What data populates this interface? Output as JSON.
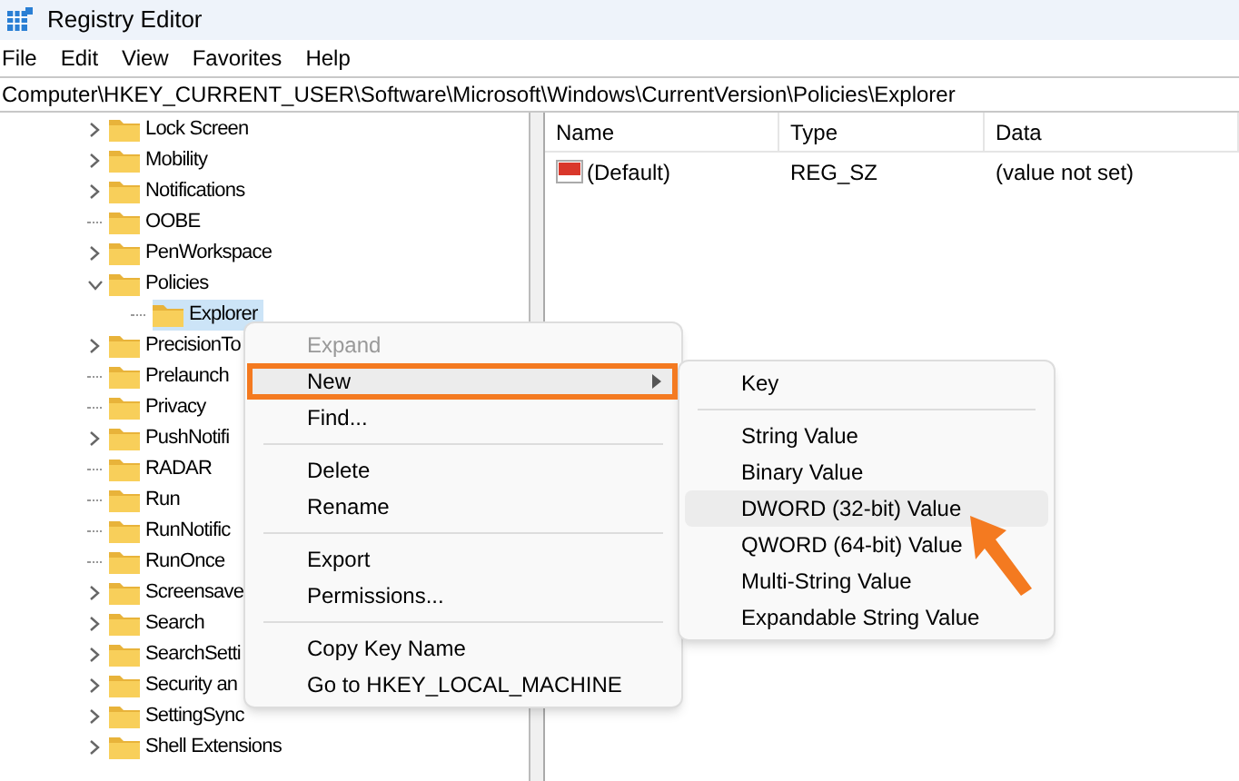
{
  "window": {
    "title": "Registry Editor"
  },
  "menu_bar": [
    "File",
    "Edit",
    "View",
    "Favorites",
    "Help"
  ],
  "address_bar": {
    "value": "Computer\\HKEY_CURRENT_USER\\Software\\Microsoft\\Windows\\CurrentVersion\\Policies\\Explorer"
  },
  "tree": [
    {
      "label": "Lock Screen",
      "kind": "collapsed",
      "selected": false
    },
    {
      "label": "Mobility",
      "kind": "collapsed",
      "selected": false
    },
    {
      "label": "Notifications",
      "kind": "collapsed",
      "selected": false
    },
    {
      "label": "OOBE",
      "kind": "leaf",
      "selected": false
    },
    {
      "label": "PenWorkspace",
      "kind": "collapsed",
      "selected": false
    },
    {
      "label": "Policies",
      "kind": "expanded",
      "selected": false,
      "children": [
        {
          "label": "Explorer",
          "kind": "leaf",
          "selected": true
        }
      ]
    },
    {
      "label": "PrecisionTo",
      "kind": "collapsed",
      "selected": false
    },
    {
      "label": "Prelaunch",
      "kind": "leaf",
      "selected": false
    },
    {
      "label": "Privacy",
      "kind": "leaf",
      "selected": false
    },
    {
      "label": "PushNotifi",
      "kind": "collapsed",
      "selected": false
    },
    {
      "label": "RADAR",
      "kind": "leaf",
      "selected": false
    },
    {
      "label": "Run",
      "kind": "leaf",
      "selected": false
    },
    {
      "label": "RunNotific",
      "kind": "leaf",
      "selected": false
    },
    {
      "label": "RunOnce",
      "kind": "leaf",
      "selected": false
    },
    {
      "label": "Screensave",
      "kind": "collapsed",
      "selected": false
    },
    {
      "label": "Search",
      "kind": "collapsed",
      "selected": false
    },
    {
      "label": "SearchSetti",
      "kind": "collapsed",
      "selected": false
    },
    {
      "label": "Security an",
      "kind": "collapsed",
      "selected": false
    },
    {
      "label": "SettingSync",
      "kind": "collapsed",
      "selected": false
    },
    {
      "label": "Shell Extensions",
      "kind": "collapsed",
      "selected": false
    }
  ],
  "values_table": {
    "columns": [
      "Name",
      "Type",
      "Data"
    ],
    "rows": [
      {
        "name": "(Default)",
        "type": "REG_SZ",
        "data": "(value not set)"
      }
    ]
  },
  "context_menu": {
    "items": [
      {
        "kind": "item",
        "label": "Expand",
        "disabled": true,
        "selected": false,
        "submenu": false
      },
      {
        "kind": "item",
        "label": "New",
        "disabled": false,
        "selected": true,
        "submenu": true
      },
      {
        "kind": "item",
        "label": "Find...",
        "disabled": false,
        "selected": false,
        "submenu": false
      },
      {
        "kind": "separator"
      },
      {
        "kind": "item",
        "label": "Delete",
        "disabled": false,
        "selected": false,
        "submenu": false
      },
      {
        "kind": "item",
        "label": "Rename",
        "disabled": false,
        "selected": false,
        "submenu": false
      },
      {
        "kind": "separator"
      },
      {
        "kind": "item",
        "label": "Export",
        "disabled": false,
        "selected": false,
        "submenu": false
      },
      {
        "kind": "item",
        "label": "Permissions...",
        "disabled": false,
        "selected": false,
        "submenu": false
      },
      {
        "kind": "separator"
      },
      {
        "kind": "item",
        "label": "Copy Key Name",
        "disabled": false,
        "selected": false,
        "submenu": false
      },
      {
        "kind": "item",
        "label": "Go to HKEY_LOCAL_MACHINE",
        "disabled": false,
        "selected": false,
        "submenu": false
      }
    ]
  },
  "submenu": {
    "items": [
      {
        "kind": "item",
        "label": "Key",
        "selected": false
      },
      {
        "kind": "separator"
      },
      {
        "kind": "item",
        "label": "String Value",
        "selected": false
      },
      {
        "kind": "item",
        "label": "Binary Value",
        "selected": false
      },
      {
        "kind": "item",
        "label": "DWORD (32-bit) Value",
        "selected": true
      },
      {
        "kind": "item",
        "label": "QWORD (64-bit) Value",
        "selected": false
      },
      {
        "kind": "item",
        "label": "Multi-String Value",
        "selected": false
      },
      {
        "kind": "item",
        "label": "Expandable String Value",
        "selected": false
      }
    ]
  }
}
